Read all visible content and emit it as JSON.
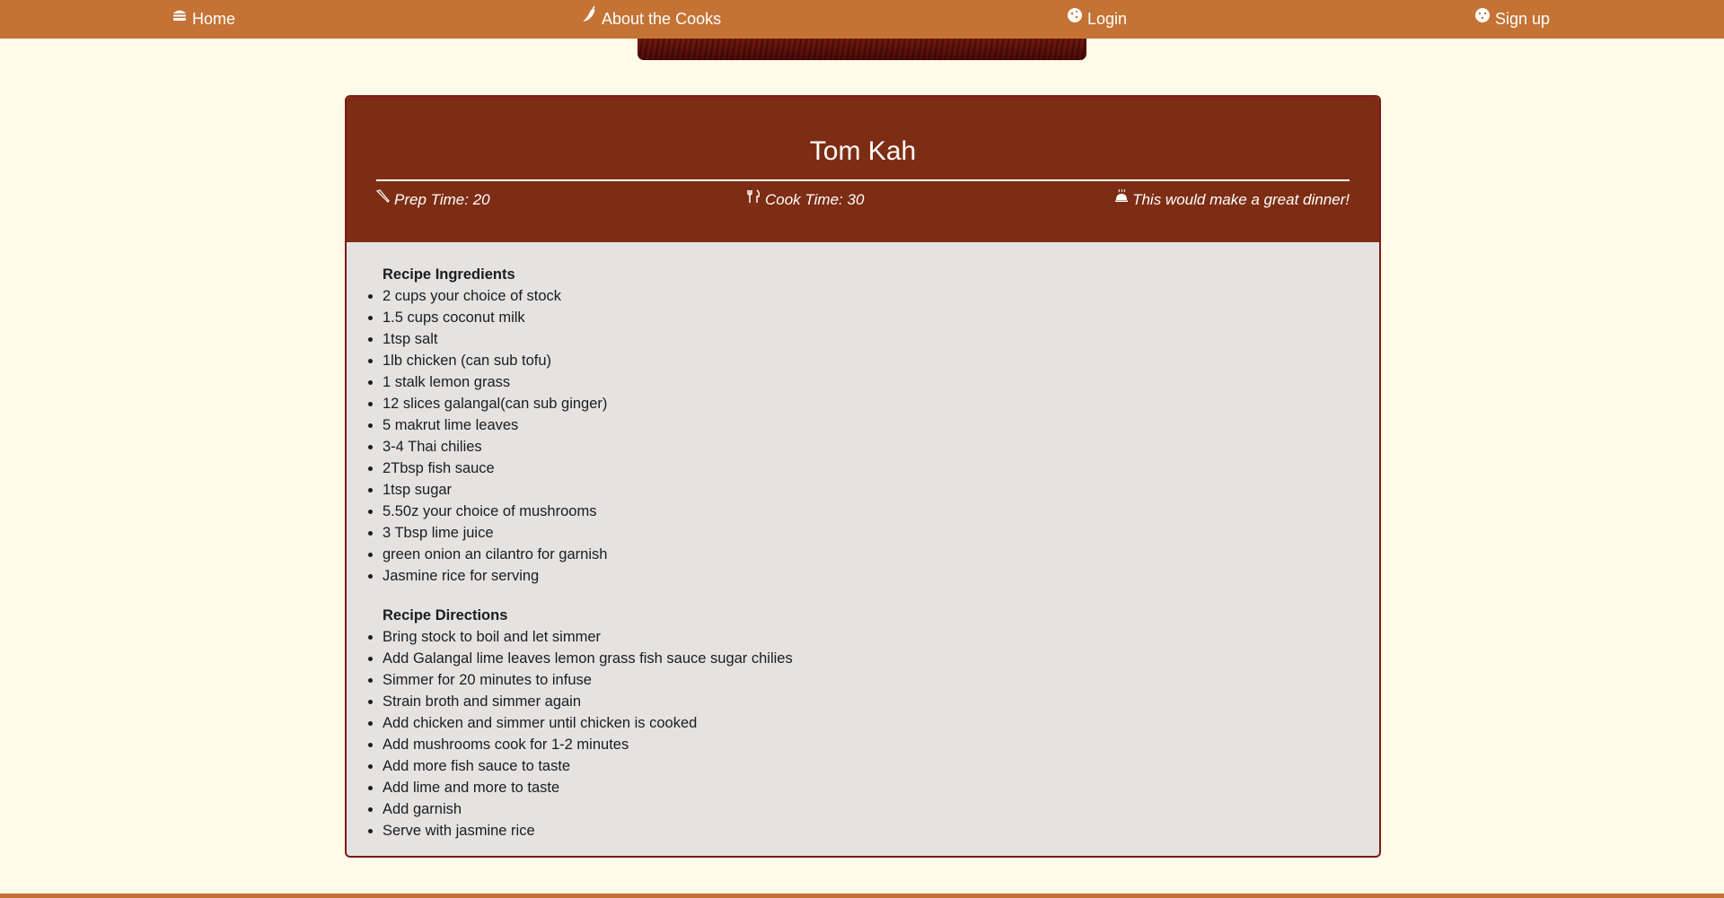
{
  "nav": {
    "home": {
      "label": "Home",
      "icon": "burger-icon"
    },
    "about": {
      "label": "About the Cooks",
      "icon": "pepper-icon"
    },
    "login": {
      "label": "Login",
      "icon": "cookie-icon"
    },
    "signup": {
      "label": "Sign up",
      "icon": "cookie-face-icon"
    }
  },
  "recipe": {
    "title": "Tom Kah",
    "prep": "Prep Time: 20",
    "cook": "Cook Time: 30",
    "meal_note": "This would make a great dinner!",
    "ingredients_heading": "Recipe Ingredients",
    "ingredients": [
      "2 cups your choice of stock",
      "1.5 cups coconut milk",
      "1tsp salt",
      "1lb chicken (can sub tofu)",
      "1 stalk lemon grass",
      "12 slices galangal(can sub ginger)",
      "5 makrut lime leaves",
      "3-4 Thai chilies",
      "2Tbsp fish sauce",
      "1tsp sugar",
      "5.50z your choice of mushrooms",
      "3 Tbsp lime juice",
      "green onion an cilantro for garnish",
      "Jasmine rice for serving"
    ],
    "directions_heading": "Recipe Directions",
    "directions": [
      "Bring stock to boil and let simmer",
      "Add Galangal lime leaves lemon grass fish sauce sugar chilies",
      "Simmer for 20 minutes to infuse",
      "Strain broth and simmer again",
      "Add chicken and simmer until chicken is cooked",
      "Add mushrooms cook for 1-2 minutes",
      "Add more fish sauce to taste",
      "Add lime and more to taste",
      "Add garnish",
      "Serve with jasmine rice"
    ]
  },
  "colors": {
    "navbar": "#c47335",
    "page_bg": "#fffbe9",
    "card_header": "#7d2d14",
    "card_body": "#e5e3e2",
    "card_border": "#7d1b17"
  }
}
